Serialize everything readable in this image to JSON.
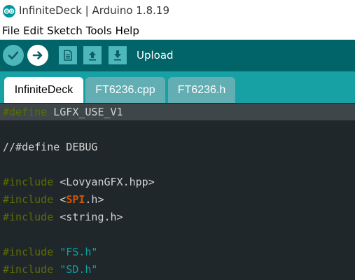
{
  "window": {
    "title": "InfiniteDeck | Arduino 1.8.19",
    "app_icon": "arduino-logo-icon"
  },
  "menu": {
    "items": [
      "File",
      "Edit",
      "Sketch",
      "Tools",
      "Help"
    ]
  },
  "toolbar": {
    "buttons": [
      {
        "name": "verify",
        "icon": "checkmark-icon"
      },
      {
        "name": "upload",
        "icon": "right-arrow-icon"
      },
      {
        "name": "new",
        "icon": "new-document-icon"
      },
      {
        "name": "open",
        "icon": "up-arrow-icon"
      },
      {
        "name": "save",
        "icon": "down-arrow-icon"
      }
    ],
    "status": "Upload"
  },
  "tabs": [
    {
      "label": "InfiniteDeck",
      "selected": true
    },
    {
      "label": "FT6236.cpp",
      "selected": false
    },
    {
      "label": "FT6236.h",
      "selected": false
    }
  ],
  "code": {
    "lines": [
      {
        "t1": "#define",
        "t2": " LGFX_USE_V1"
      },
      {
        "t1": ""
      },
      {
        "t1": "//#define DEBUG"
      },
      {
        "t1": ""
      },
      {
        "t1": "#include",
        "t2": " <LovyanGFX.hpp>"
      },
      {
        "t1": "#include",
        "t2": " <",
        "t3": "SPI",
        "t4": ".h>"
      },
      {
        "t1": "#include",
        "t2": " <string.h>"
      },
      {
        "t1": ""
      },
      {
        "t1": "#include",
        "t2": " ",
        "t3": "\"FS.h\""
      },
      {
        "t1": "#include",
        "t2": " ",
        "t3": "\"SD.h\""
      }
    ]
  },
  "colors": {
    "toolbar_bg": "#006468",
    "tabbar_bg": "#17a1a5",
    "editor_bg": "#1f272a",
    "directive": "#5e6d03",
    "keyword": "#d35400",
    "string": "#0ca1a6"
  }
}
